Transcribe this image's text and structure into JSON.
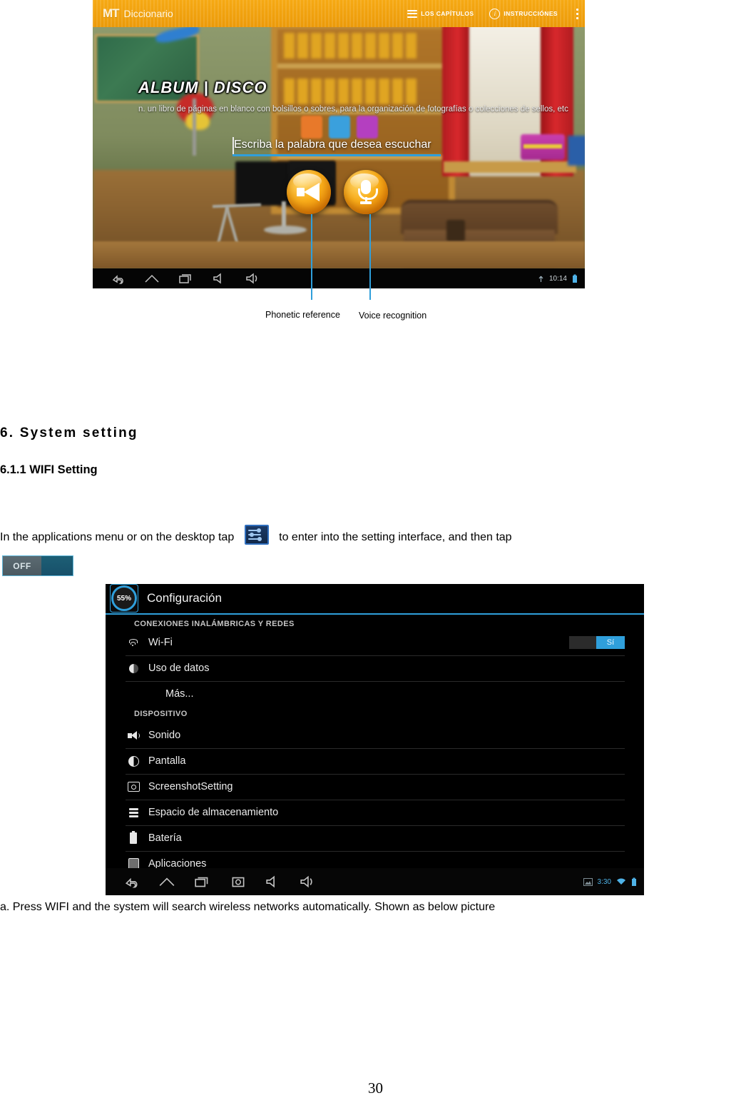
{
  "figure1": {
    "app_bar": {
      "logo": "MT",
      "title": "Diccionario",
      "chapters_label": "LOS CAPÍTULOS",
      "instructions_label": "INSTRUCCIÓNES",
      "info_glyph": "i",
      "accent_color": "#f2a00c"
    },
    "word": {
      "title": "ALBUM | DISCO",
      "definition": "n. un libro de páginas en blanco con bolsillos o sobres, para la organización de fotografías o colecciones de sellos, etc"
    },
    "prompt": "Escriba la palabra que desea escuchar",
    "buttons": {
      "speaker": "speaker-button",
      "microphone": "microphone-button"
    },
    "nav": {
      "back": "back-icon",
      "home": "home-icon",
      "recents": "recents-icon",
      "volume_down": "volume-down-icon",
      "volume_up": "volume-up-icon",
      "time": "10:14"
    },
    "callouts": {
      "left": "Phonetic reference",
      "right": "Voice recognition",
      "line_color": "#2f9fdb"
    }
  },
  "headings": {
    "section": "6. System setting",
    "subsection": "6.1.1 WIFI Setting"
  },
  "body": {
    "para_part1": "In the applications menu or on the desktop tap",
    "para_part2": "to enter into the setting interface, and then tap",
    "settings_icon_name": "settings-sliders-icon",
    "off_toggle_label": "OFF",
    "caption": "a. Press WIFI and the system will search wireless networks automatically. Shown as below picture"
  },
  "figure2": {
    "battery_badge": "55%",
    "title": "Configuración",
    "accent_color": "#2f9fdb",
    "sections": [
      {
        "header": "CONEXIONES INALÁMBRICAS Y REDES",
        "rows": [
          {
            "label": "Wi-Fi",
            "icon": "wifi-icon",
            "toggle": "Sí",
            "indent": false
          },
          {
            "label": "Uso de datos",
            "icon": "data-usage-icon",
            "toggle": "",
            "indent": false
          },
          {
            "label": "Más...",
            "icon": "",
            "toggle": "",
            "indent": true
          }
        ]
      },
      {
        "header": "DISPOSITIVO",
        "rows": [
          {
            "label": "Sonido",
            "icon": "sound-icon",
            "toggle": "",
            "indent": false
          },
          {
            "label": "Pantalla",
            "icon": "display-icon",
            "toggle": "",
            "indent": false
          },
          {
            "label": "ScreenshotSetting",
            "icon": "camera-icon",
            "toggle": "",
            "indent": false
          },
          {
            "label": "Espacio de almacenamiento",
            "icon": "storage-icon",
            "toggle": "",
            "indent": false
          },
          {
            "label": "Batería",
            "icon": "battery-icon",
            "toggle": "",
            "indent": false
          },
          {
            "label": "Aplicaciones",
            "icon": "applications-icon",
            "toggle": "",
            "indent": false
          }
        ]
      }
    ],
    "nav": {
      "back": "back-icon",
      "home": "home-icon",
      "recents": "recents-icon",
      "screenshot": "screenshot-icon",
      "volume_down": "volume-down-icon",
      "volume_up": "volume-up-icon",
      "time": "3:30"
    }
  },
  "page_number": "30"
}
